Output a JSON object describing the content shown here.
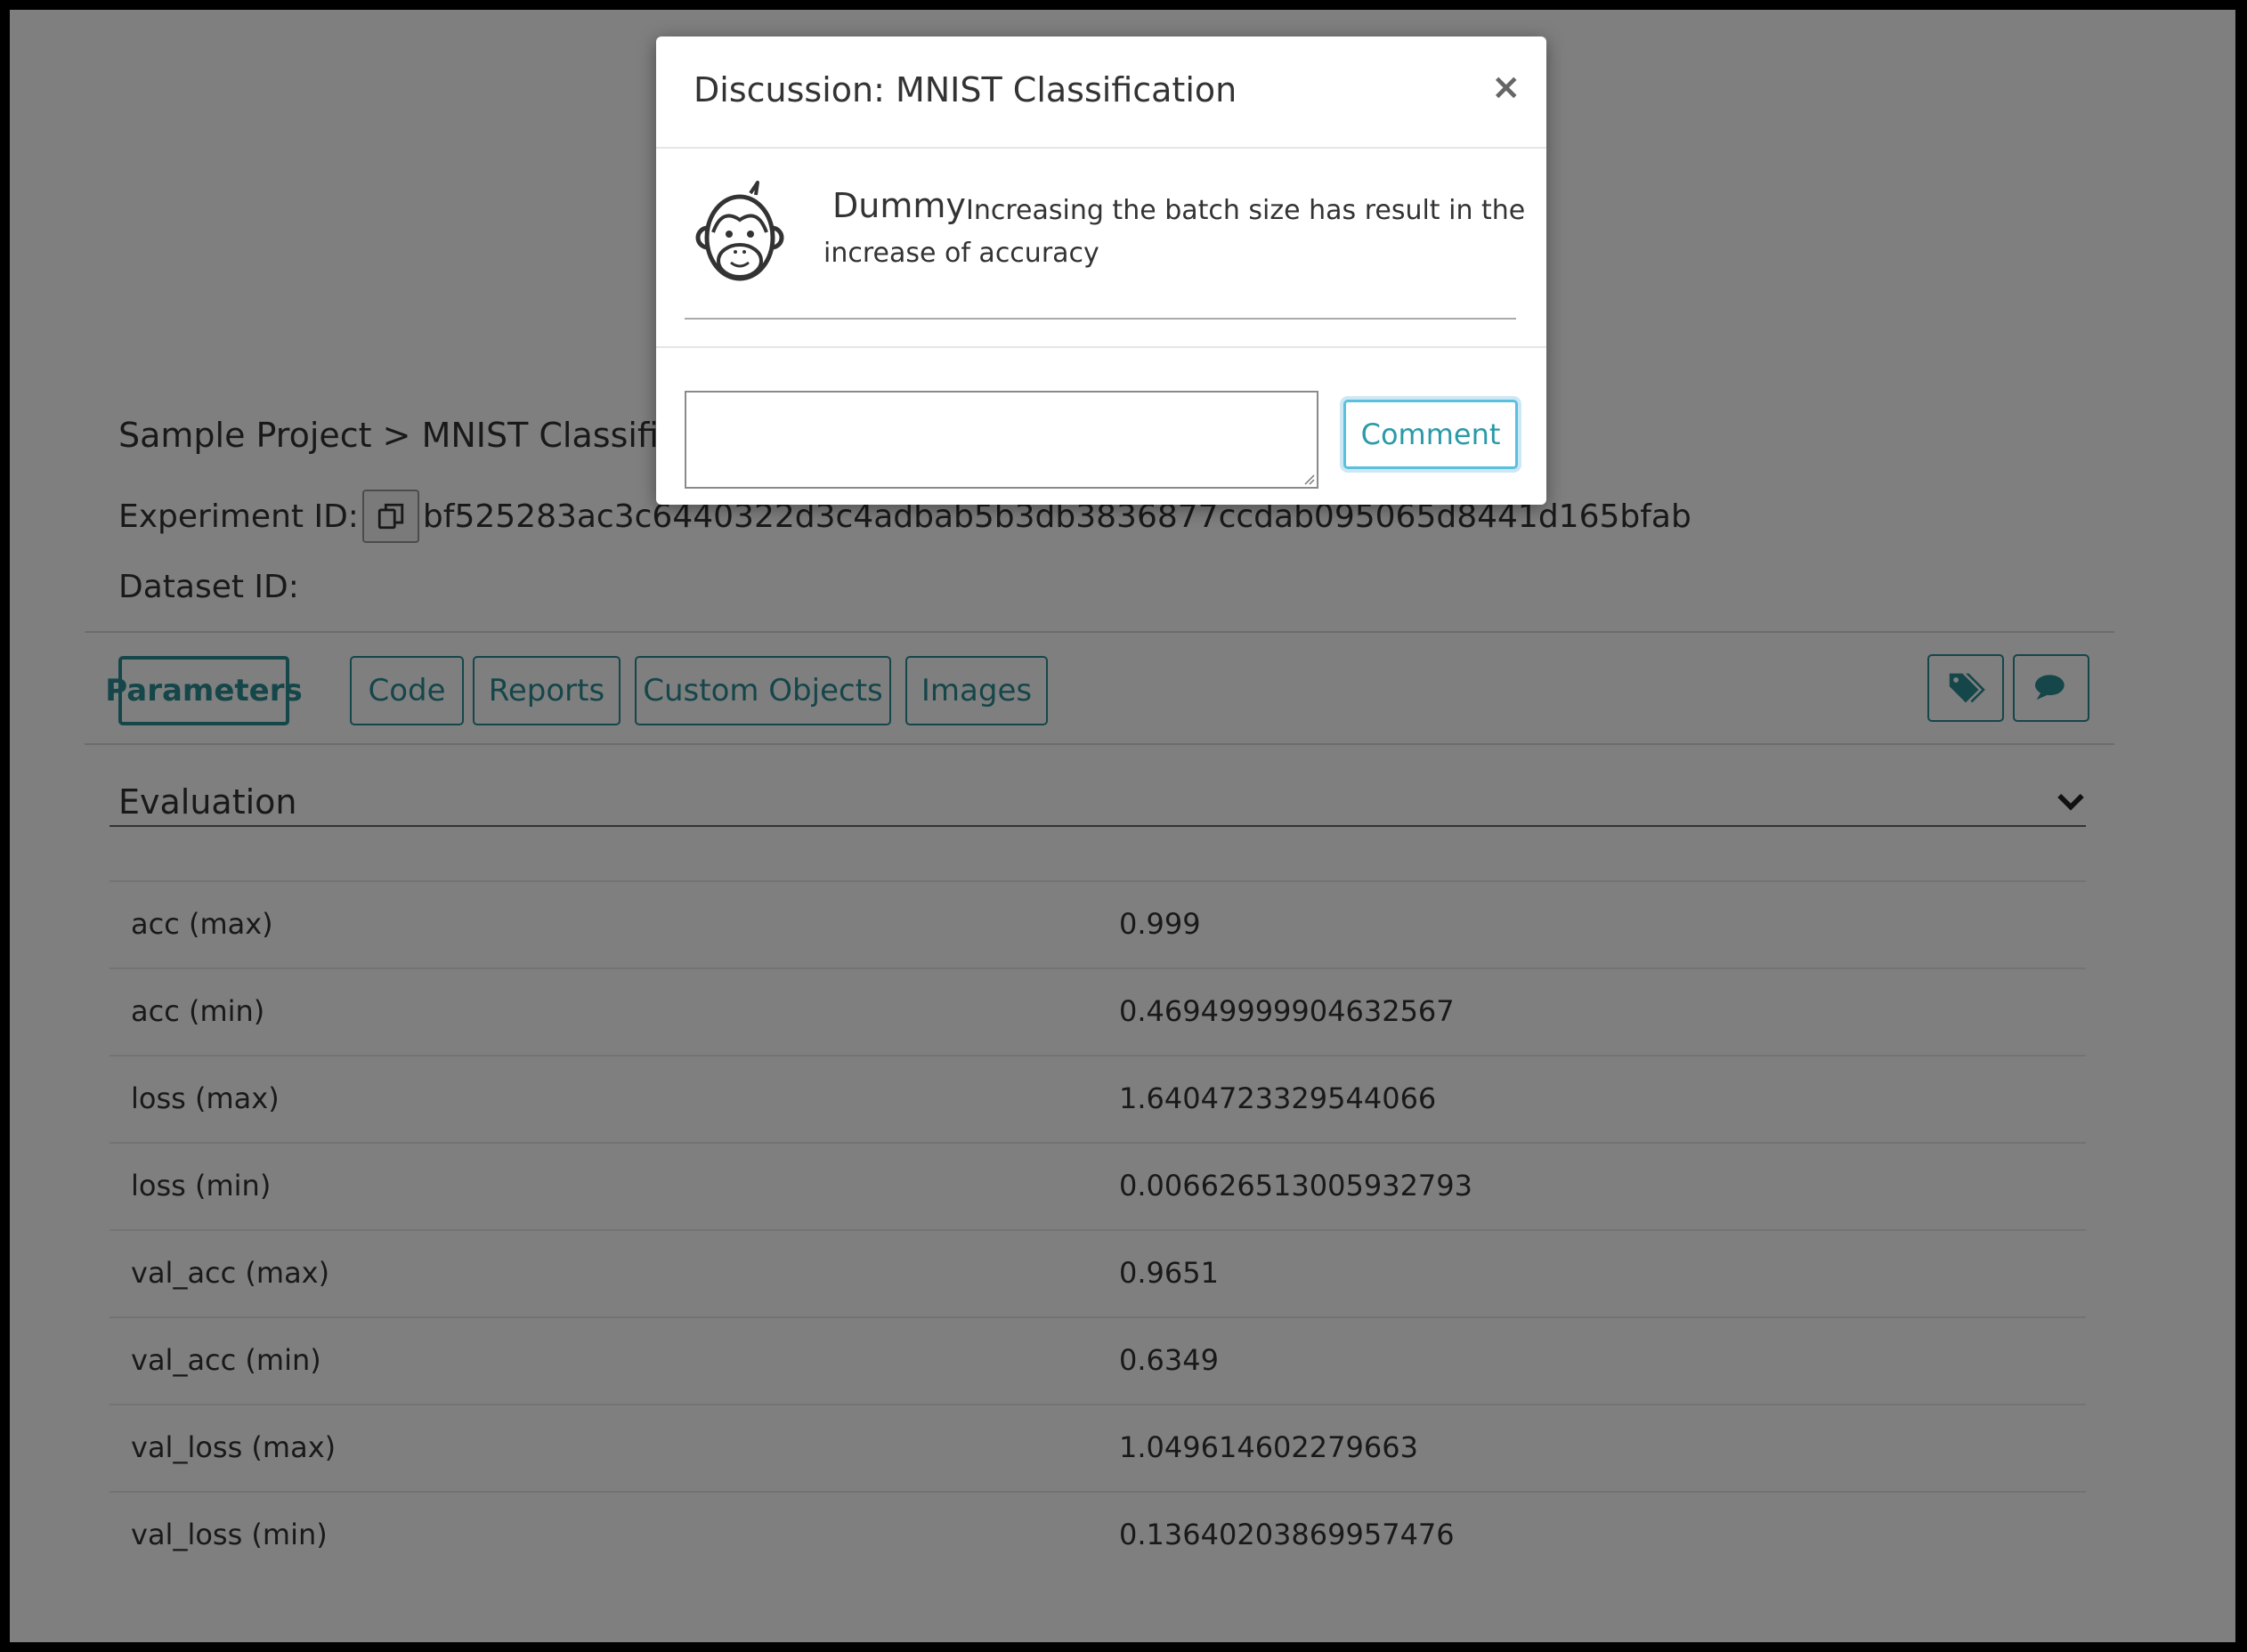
{
  "breadcrumb": "Sample Project > MNIST Classification",
  "experiment": {
    "label": "Experiment ID:",
    "copy_icon": "copy-icon",
    "id": "bf525283ac3c6440322d3c4adbab5b3db3836877ccdab095065d8441d165bfab"
  },
  "dataset": {
    "label": "Dataset ID:"
  },
  "tabs": [
    {
      "label": "Parameters",
      "active": true
    },
    {
      "label": "Code"
    },
    {
      "label": "Reports"
    },
    {
      "label": "Custom Objects"
    },
    {
      "label": "Images"
    }
  ],
  "toolbar_icons": [
    "tag-icon",
    "comment-icon"
  ],
  "evaluation": {
    "title": "Evaluation",
    "rows": [
      {
        "key": "acc (max)",
        "value": "0.999"
      },
      {
        "key": "acc (min)",
        "value": "0.46949999904632567"
      },
      {
        "key": "loss (max)",
        "value": "1.6404723329544066"
      },
      {
        "key": "loss (min)",
        "value": "0.006626513005932793"
      },
      {
        "key": "val_acc (max)",
        "value": "0.9651"
      },
      {
        "key": "val_acc (min)",
        "value": "0.6349"
      },
      {
        "key": "val_loss (max)",
        "value": "1.049614602279663"
      },
      {
        "key": "val_loss (min)",
        "value": "0.13640203869957476"
      }
    ]
  },
  "modal": {
    "title": "Discussion: MNIST Classification",
    "close": "×",
    "comments": [
      {
        "author": "Dummy",
        "text_line1": "Increasing the batch size has result in the",
        "text_line2": "increase of accuracy",
        "avatar_icon": "monkey-avatar-icon"
      }
    ],
    "input_value": "",
    "button_label": "Comment"
  },
  "colors": {
    "accent": "#2a8c94",
    "overlay": "rgba(0,0,0,0.5)",
    "button_focus": "#5bc0de"
  }
}
